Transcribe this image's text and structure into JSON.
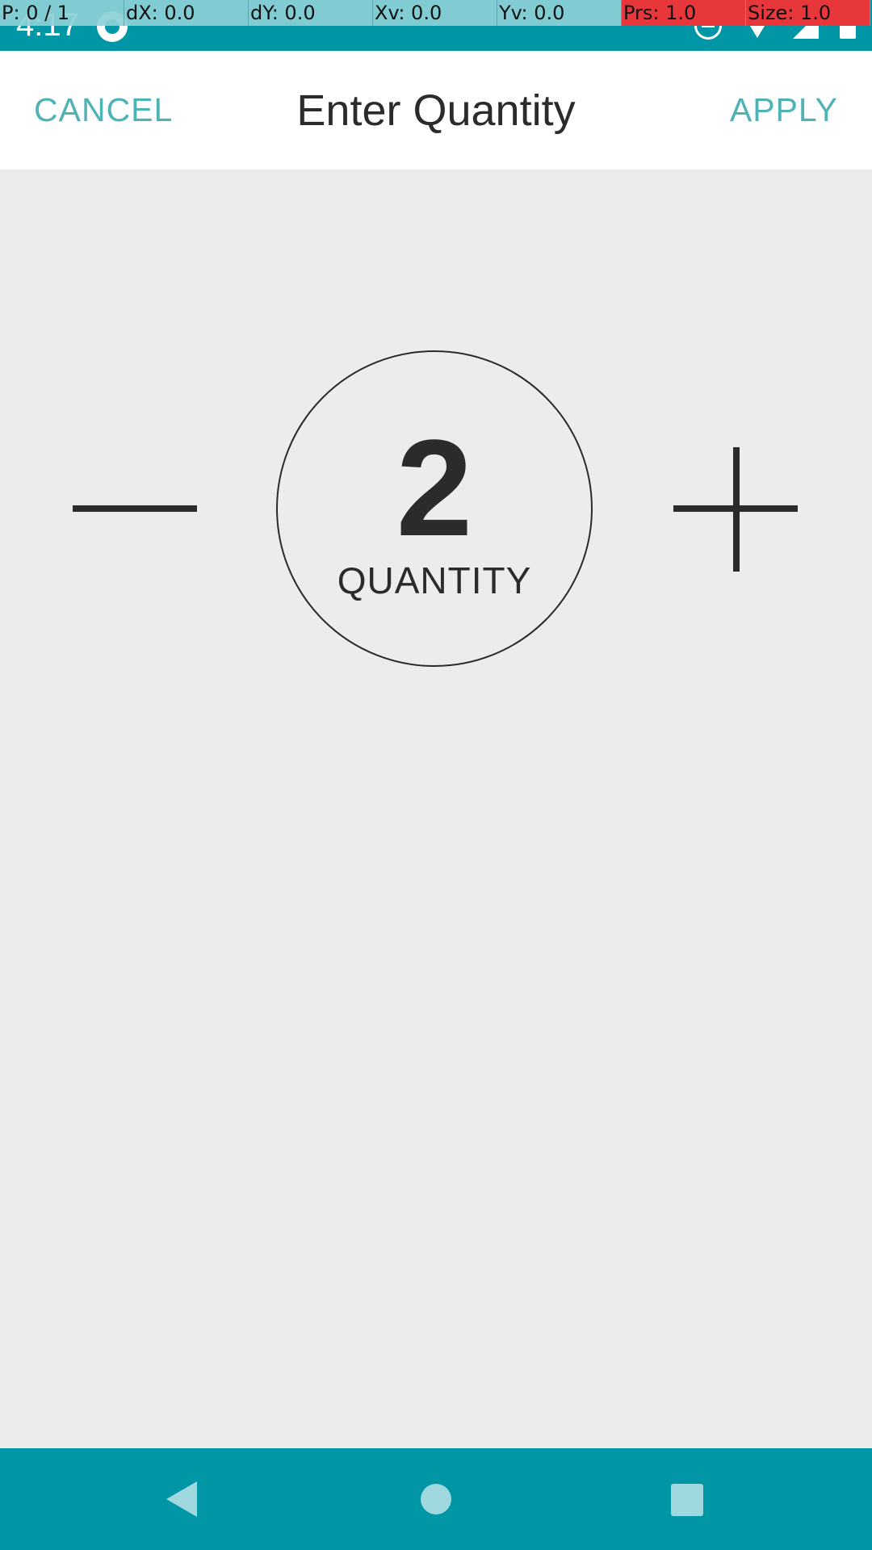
{
  "status_bar": {
    "time": "4:17",
    "icons": [
      "app-notification-icon",
      "do-not-disturb-icon",
      "wifi-icon",
      "cell-signal-icon",
      "battery-icon"
    ]
  },
  "debug_overlay": [
    "P: 0 / 1",
    "dX: 0.0",
    "dY: 0.0",
    "Xv: 0.0",
    "Yv: 0.0",
    "Prs: 1.0",
    "Size: 1.0"
  ],
  "toolbar": {
    "cancel_label": "CANCEL",
    "title": "Enter Quantity",
    "apply_label": "APPLY"
  },
  "quantity": {
    "value": "2",
    "label": "QUANTITY"
  },
  "nav_bar": {
    "buttons": [
      "back-icon",
      "home-icon",
      "recents-icon"
    ]
  },
  "colors": {
    "status_bar": "#0096a6",
    "accent": "#4fb3b5",
    "background": "#ececec",
    "text": "#2b2b2b",
    "debug_alert": "#e8373a"
  }
}
